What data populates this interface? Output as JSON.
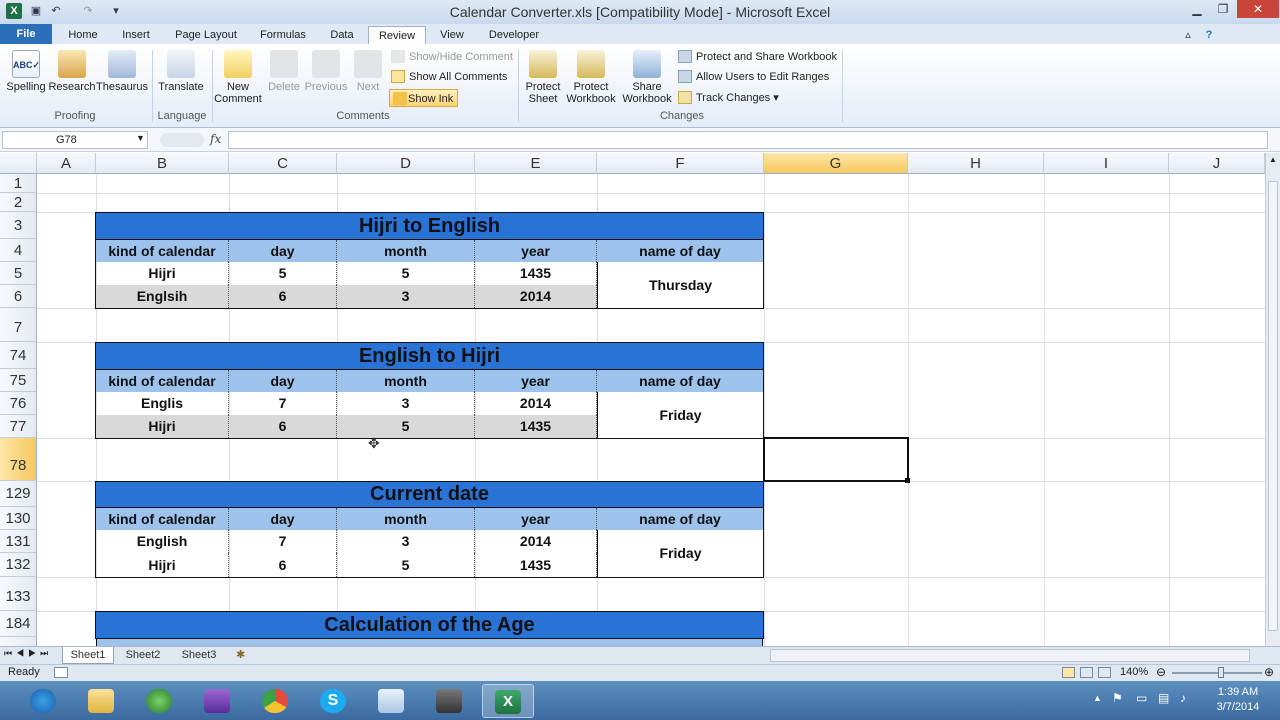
{
  "window": {
    "title": "Calendar Converter.xls  [Compatibility Mode]  -  Microsoft Excel",
    "minimize": "▁",
    "restore": "❐",
    "close": "✕"
  },
  "tabs": [
    "File",
    "Home",
    "Insert",
    "Page Layout",
    "Formulas",
    "Data",
    "Review",
    "View",
    "Developer"
  ],
  "ribbon": {
    "proofing": {
      "spelling": "Spelling",
      "research": "Research",
      "thesaurus": "Thesaurus",
      "label": "Proofing"
    },
    "language": {
      "translate": "Translate",
      "label": "Language"
    },
    "comments": {
      "new1": "New",
      "new2": "Comment",
      "delete": "Delete",
      "previous": "Previous",
      "next": "Next",
      "show_hide": "Show/Hide Comment",
      "show_all": "Show All Comments",
      "show_ink": "Show Ink",
      "label": "Comments"
    },
    "changes": {
      "protect_sheet1": "Protect",
      "protect_sheet2": "Sheet",
      "protect_wb1": "Protect",
      "protect_wb2": "Workbook",
      "share_wb1": "Share",
      "share_wb2": "Workbook",
      "protect_share": "Protect and Share Workbook",
      "allow_users": "Allow Users to Edit Ranges",
      "track_changes": "Track Changes ▾",
      "label": "Changes"
    }
  },
  "formula_bar": {
    "name_box": "G78",
    "fx": "fx",
    "formula": ""
  },
  "columns": [
    "A",
    "B",
    "C",
    "D",
    "E",
    "F",
    "G",
    "H",
    "I",
    "J"
  ],
  "rows": [
    "1",
    "2",
    "3",
    "4",
    "5",
    "6",
    "7",
    "74",
    "75",
    "76",
    "77",
    "78",
    "129",
    "130",
    "131",
    "132",
    "133",
    "184"
  ],
  "sections": {
    "hijri_to_english": {
      "title": "Hijri to English",
      "headers": [
        "kind of calendar",
        "day",
        "month",
        "year",
        "name of day"
      ],
      "rows": [
        [
          "Hijri",
          "5",
          "5",
          "1435"
        ],
        [
          "Englsih",
          "6",
          "3",
          "2014"
        ]
      ],
      "day_name": "Thursday"
    },
    "english_to_hijri": {
      "title": "English to Hijri",
      "headers": [
        "kind of calendar",
        "day",
        "month",
        "year",
        "name of day"
      ],
      "rows": [
        [
          "Englis",
          "7",
          "3",
          "2014"
        ],
        [
          "Hijri",
          "6",
          "5",
          "1435"
        ]
      ],
      "day_name": "Friday"
    },
    "current_date": {
      "title": "Current date",
      "headers": [
        "kind of calendar",
        "day",
        "month",
        "year",
        "name of day"
      ],
      "rows": [
        [
          "English",
          "7",
          "3",
          "2014"
        ],
        [
          "Hijri",
          "6",
          "5",
          "1435"
        ]
      ],
      "day_name": "Friday"
    },
    "age": {
      "title": "Calculation of the Age"
    }
  },
  "sheets": [
    "Sheet1",
    "Sheet2",
    "Sheet3"
  ],
  "status": {
    "mode": "Ready",
    "zoom": "140%"
  },
  "clock": {
    "time": "1:39 AM",
    "date": "3/7/2014"
  },
  "colors": {
    "title_fill": "#2a73d6",
    "header_fill": "#9dc3ec",
    "alt_row_fill": "#d9d9d9",
    "accent": "#2a6fb8"
  }
}
